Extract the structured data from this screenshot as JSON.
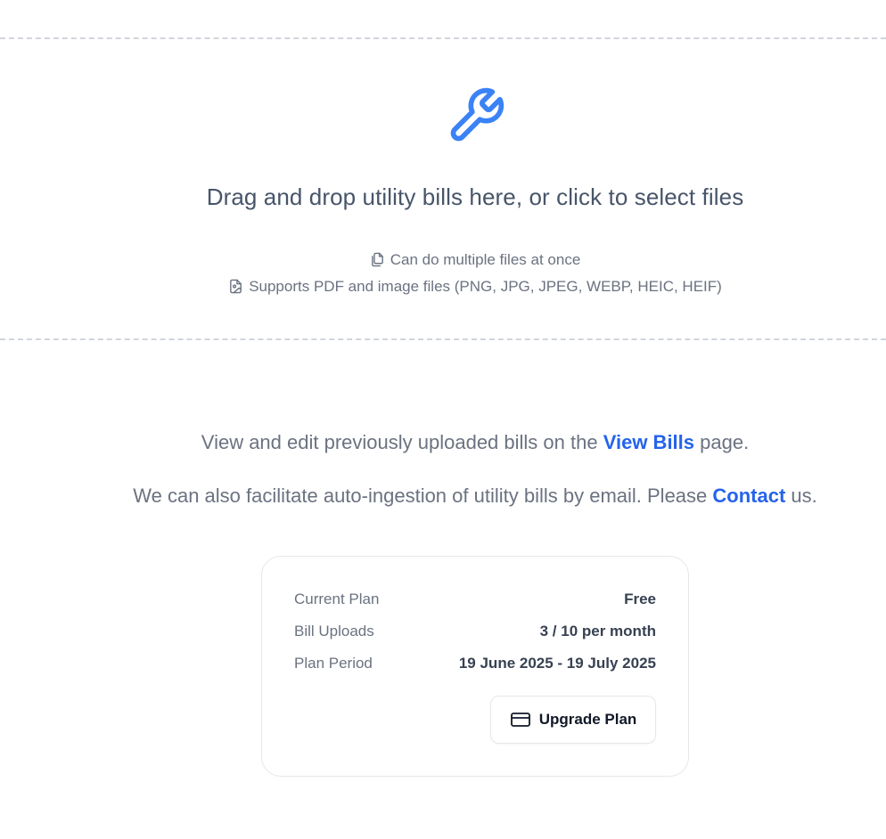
{
  "dropzone": {
    "icon": "wrench-icon",
    "title": "Drag and drop utility bills here, or click to select files",
    "hints": [
      {
        "icon": "copy-files-icon",
        "text": "Can do multiple files at once"
      },
      {
        "icon": "image-file-icon",
        "text": "Supports PDF and image files (PNG, JPG, JPEG, WEBP, HEIC, HEIF)"
      }
    ]
  },
  "info": {
    "line1_prefix": "View and edit previously uploaded bills on the ",
    "line1_link": "View Bills",
    "line1_suffix": " page.",
    "line2_prefix": "We can also facilitate auto-ingestion of utility bills by email. Please ",
    "line2_link": "Contact",
    "line2_suffix": " us."
  },
  "plan": {
    "rows": [
      {
        "label": "Current Plan",
        "value": "Free"
      },
      {
        "label": "Bill Uploads",
        "value": "3 / 10 per month"
      },
      {
        "label": "Plan Period",
        "value": "19 June 2025 - 19 July 2025"
      }
    ],
    "upgrade_label": "Upgrade Plan",
    "upgrade_icon": "credit-card-icon"
  },
  "colors": {
    "accent": "#2563eb",
    "icon_blue": "#3b82f6",
    "dashed_border": "#d1d5db"
  }
}
